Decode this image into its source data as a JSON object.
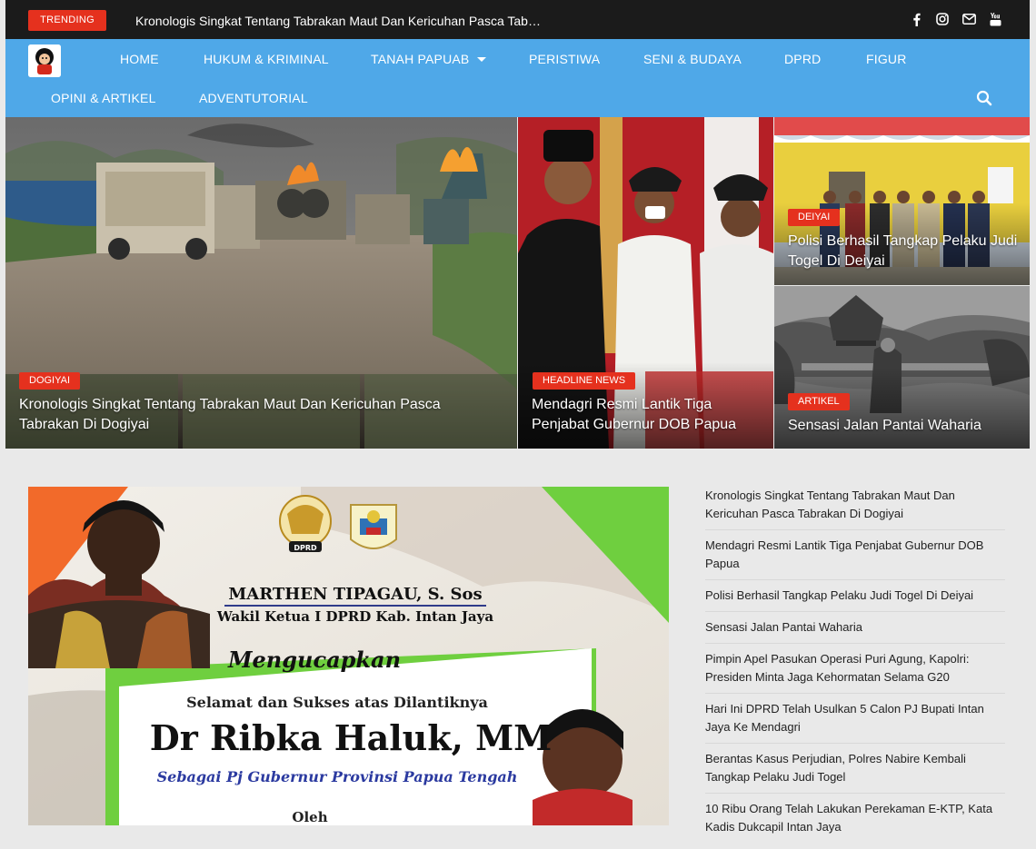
{
  "topbar": {
    "trending_label": "TRENDING",
    "trending_text": "Kronologis Singkat Tentang Tabrakan Maut Dan Kericuhan Pasca Tab…",
    "social_icons": [
      "facebook-icon",
      "instagram-icon",
      "mail-icon",
      "youtube-icon"
    ]
  },
  "nav": {
    "items": [
      {
        "label": "HOME"
      },
      {
        "label": "HUKUM & KRIMINAL"
      },
      {
        "label": "TANAH PAPUAB"
      },
      {
        "label": "PERISTIWA"
      },
      {
        "label": "SENI & BUDAYA"
      },
      {
        "label": "DPRD"
      },
      {
        "label": "FIGUR"
      },
      {
        "label": "OPINI & ARTIKEL"
      },
      {
        "label": "ADVENTUTORIAL"
      }
    ]
  },
  "hero": {
    "main": {
      "tag": "DOGIYAI",
      "title": "Kronologis Singkat Tentang Tabrakan Maut Dan Kericuhan Pasca Tabrakan Di Dogiyai"
    },
    "center": {
      "tag": "HEADLINE NEWS",
      "title": "Mendagri Resmi Lantik Tiga Penjabat Gubernur DOB Papua"
    },
    "right_top": {
      "tag": "DEIYAI",
      "title": "Polisi Berhasil Tangkap Pelaku Judi Togel Di Deiyai"
    },
    "right_bottom": {
      "tag": "ARTIKEL",
      "title": "Sensasi Jalan Pantai Waharia"
    }
  },
  "banner": {
    "person_name": "MARTHEN TIPAGAU, S. Sos",
    "person_role": "Wakil Ketua I DPRD Kab. Intan Jaya",
    "script_heading": "Mengucapkan",
    "congrats_line": "Selamat dan Sukses atas Dilantiknya",
    "honoree": "Dr Ribka Haluk, MM",
    "honoree_role": "Sebagai Pj Gubernur Provinsi Papua Tengah",
    "footer_word": "Oleh",
    "seal_label": "DPRD"
  },
  "sidebar": {
    "items": [
      {
        "title": "Kronologis Singkat Tentang Tabrakan Maut Dan Kericuhan Pasca Tabrakan Di Dogiyai"
      },
      {
        "title": "Mendagri Resmi Lantik Tiga Penjabat Gubernur DOB Papua"
      },
      {
        "title": "Polisi Berhasil Tangkap Pelaku Judi Togel Di Deiyai"
      },
      {
        "title": "Sensasi Jalan Pantai Waharia"
      },
      {
        "title": "Pimpin Apel Pasukan Operasi Puri Agung, Kapolri: Presiden Minta Jaga Kehormatan Selama G20"
      },
      {
        "title": "Hari Ini DPRD Telah Usulkan 5 Calon PJ Bupati Intan Jaya Ke Mendagri"
      },
      {
        "title": "Berantas Kasus Perjudian, Polres Nabire Kembali Tangkap Pelaku Judi Togel"
      },
      {
        "title": "10 Ribu Orang Telah Lakukan Perekaman E-KTP, Kata Kadis Dukcapil Intan Jaya"
      }
    ]
  },
  "colors": {
    "topbar_bg": "#1b1b1b",
    "nav_bg": "#4fa8e8",
    "tag_red": "#e5311e",
    "page_bg": "#e9e9e9"
  }
}
